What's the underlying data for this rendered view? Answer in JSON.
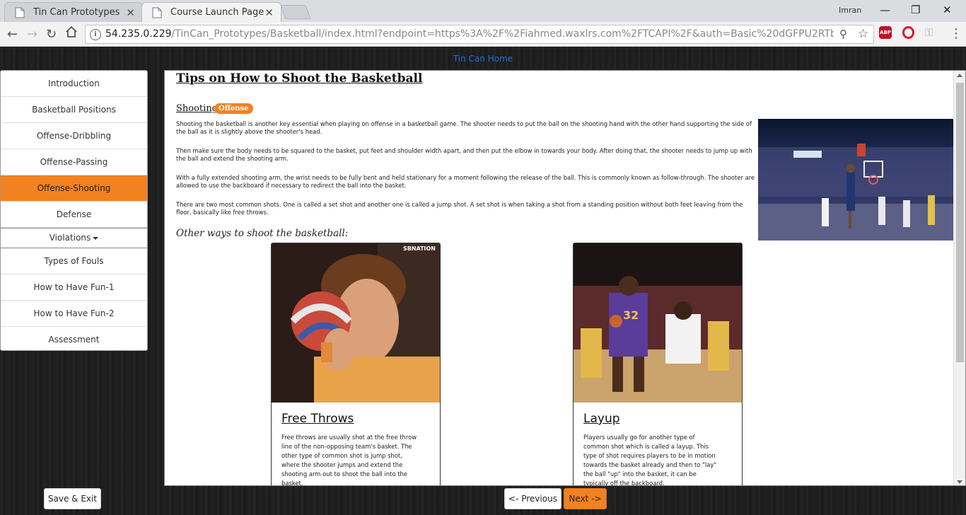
{
  "browser": {
    "tabs": [
      {
        "title": "Tin Can Prototypes",
        "active": false
      },
      {
        "title": "Course Launch Page",
        "active": true
      }
    ],
    "user": "Imran",
    "url_host": "54.235.0.229",
    "url_rest": "/TinCan_Prototypes/Basketball/index.html?endpoint=https%3A%2F%2Fiahmed.waxlrs.com%2FTCAPI%2F&auth=Basic%20dGFPU2RTb09pUXZVejlWcmF2...",
    "extensions": {
      "abp": "ABP"
    }
  },
  "header": {
    "home_link": "Tin Can Home"
  },
  "sidebar": {
    "items": [
      {
        "label": "Introduction"
      },
      {
        "label": "Basketball Positions"
      },
      {
        "label": "Offense-Dribbling"
      },
      {
        "label": "Offense-Passing"
      },
      {
        "label": "Offense-Shooting",
        "active": true
      },
      {
        "label": "Defense"
      },
      {
        "label": "Violations",
        "dropdown": true
      },
      {
        "label": "Types of Fouls"
      },
      {
        "label": "How to Have Fun-1"
      },
      {
        "label": "How to Have Fun-2"
      },
      {
        "label": "Assessment"
      }
    ]
  },
  "content": {
    "title": "Tips on How to Shoot the Basketball",
    "section": "Shooting",
    "badge": "Offense",
    "paragraphs": [
      "Shooting the basketball is another key essential when playing on offense in a basketball game. The shooter needs to put the ball on the shooting hand with the other hand supporting the side of the ball as it is slightly above the shooter's head.",
      "Then make sure the body needs to be squared to the basket, put feet and shoulder width apart, and then put the elbow in towards your body. After doing that, the shooter needs to jump up with the ball and extend the shooting arm.",
      "With a fully extended shooting arm, the wrist needs to be fully bent and held stationary for a moment following the release of the ball. This is commonly known as follow-through. The shooter are allowed to use the backboard if necessary to redirect the ball into the basket.",
      "There are two most common shots. One is called a set shot and another one is called a jump shot. A set shot is when taking a shot from a standing position without both feet leaving from the floor, basically like free throws."
    ],
    "subheading": "Other ways to shoot the basketball:",
    "cards": [
      {
        "title": "Free Throws",
        "watermark": "SBNATION",
        "text": "Free throws are usually shot at the free throw line of the non-opposing team's basket. The other type of common shot is jump shot, where the shooter jumps and extend the shooting arm out to shoot the ball into the basket."
      },
      {
        "title": "Layup",
        "jersey_number": "32",
        "text": "Players usually go for another type of common shot which is called a layup. This type of shot requires players to be in motion towards the basket already and then to \"lay\" the ball \"up\" into the basket, it can be typically off the backboard."
      }
    ]
  },
  "footer": {
    "save_exit": "Save & Exit",
    "previous": "<- Previous",
    "next": "Next ->"
  },
  "colors": {
    "accent": "#f2821f",
    "link": "#1b72d9"
  }
}
